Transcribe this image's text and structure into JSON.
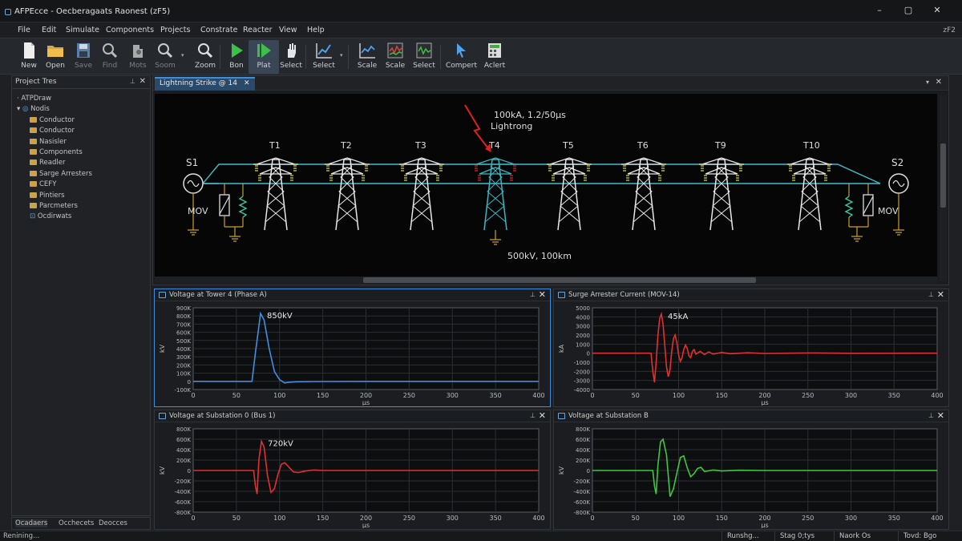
{
  "window": {
    "title": "AFPEcce - Oecberagaats Raonest (zF5)",
    "version": "zF2"
  },
  "menu": [
    "File",
    "Edit",
    "Simulate",
    "Components",
    "Projects",
    "Constrate",
    "Reacter",
    "View",
    "Help"
  ],
  "toolbar": [
    {
      "label": "New",
      "icon": "new-file-icon",
      "enabled": true
    },
    {
      "label": "Open",
      "icon": "open-folder-icon",
      "enabled": true
    },
    {
      "label": "Save",
      "icon": "save-icon",
      "enabled": false
    },
    {
      "label": "Find",
      "icon": "find-icon",
      "enabled": false
    },
    {
      "label": "Mots",
      "icon": "tools-icon",
      "enabled": false
    },
    {
      "label": "Soom",
      "icon": "zoom-icon",
      "enabled": false
    },
    {
      "label": "Zoom",
      "icon": "zoom-icon",
      "enabled": true
    },
    {
      "label": "Bon",
      "icon": "run-icon",
      "enabled": true
    },
    {
      "label": "Plat",
      "icon": "plot-run-icon",
      "enabled": true,
      "active": true
    },
    {
      "label": "Select",
      "icon": "hand-icon",
      "enabled": true
    },
    {
      "label": "Select",
      "icon": "line-chart-icon",
      "enabled": true
    },
    {
      "label": "Scale",
      "icon": "scale-chart-icon",
      "enabled": true
    },
    {
      "label": "Scale",
      "icon": "grid-chart-icon",
      "enabled": true
    },
    {
      "label": "Select",
      "icon": "green-chart-icon",
      "enabled": true
    },
    {
      "label": "Compert",
      "icon": "cursor-icon",
      "enabled": true
    },
    {
      "label": "Aclert",
      "icon": "calculator-icon",
      "enabled": true
    }
  ],
  "project_tree": {
    "title": "Project Tres",
    "items": [
      {
        "label": "ATPDraw",
        "level": 0,
        "kind": "text"
      },
      {
        "label": "Nodis",
        "level": 0,
        "kind": "node"
      },
      {
        "label": "Conductor",
        "level": 1,
        "kind": "folder"
      },
      {
        "label": "Conductor",
        "level": 1,
        "kind": "folder"
      },
      {
        "label": "Nasisler",
        "level": 1,
        "kind": "folder"
      },
      {
        "label": "Components",
        "level": 1,
        "kind": "folder"
      },
      {
        "label": "Readler",
        "level": 1,
        "kind": "folder"
      },
      {
        "label": "Sarge Arresters",
        "level": 1,
        "kind": "folder"
      },
      {
        "label": "CEFY",
        "level": 1,
        "kind": "folder"
      },
      {
        "label": "Pintiers",
        "level": 1,
        "kind": "folder"
      },
      {
        "label": "Parcmeters",
        "level": 1,
        "kind": "folder"
      },
      {
        "label": "Ocdirwats",
        "level": 1,
        "kind": "special"
      }
    ]
  },
  "bottom_tabs": [
    "Ocadaers",
    "Occhecets",
    "Deocces"
  ],
  "status": {
    "left": "Renining...",
    "boxes": [
      "Runshg...",
      "Stag 0;tys",
      "Naork Os",
      "Tovd: Bgo"
    ]
  },
  "document": {
    "tab_label": "Lightning Strike @ 14",
    "lightning_label": [
      "100kA, 1.2/50µs",
      "Lightrong"
    ],
    "line_label": "500kV, 100km",
    "sources": [
      "S1",
      "S2"
    ],
    "mov_labels": [
      "MOV",
      "MOV"
    ],
    "towers": [
      "T1",
      "T2",
      "T3",
      "T4",
      "T5",
      "T6",
      "T9",
      "T10"
    ],
    "struck_tower": "T4",
    "colors": {
      "line": "#41bcc8",
      "struck": "#3ab6c4",
      "lightning": "#e02020",
      "tower": "#e8e8e8",
      "insulator": "#d8d820",
      "ground": "#c8a030"
    }
  },
  "plots": [
    {
      "title": "Voltage at Tower 4 (Phase A)",
      "peak_label": "850kV",
      "color": "#3f8fe0",
      "ylabel": "kV",
      "xlabel": "µs",
      "yticks": [
        "900K",
        "800K",
        "700K",
        "600K",
        "500K",
        "400K",
        "300K",
        "200K",
        "100K",
        "0",
        "-100K"
      ],
      "xticks": [
        "0",
        "50",
        "100",
        "150",
        "200",
        "250",
        "300",
        "350",
        "400"
      ],
      "chart_data": {
        "type": "line",
        "x_range": [
          0,
          400
        ],
        "y_range": [
          -100,
          900
        ],
        "series": [
          {
            "points": [
              [
                0,
                0
              ],
              [
                68,
                0
              ],
              [
                72,
                350
              ],
              [
                78,
                830
              ],
              [
                82,
                750
              ],
              [
                88,
                400
              ],
              [
                94,
                120
              ],
              [
                100,
                20
              ],
              [
                106,
                -20
              ],
              [
                112,
                -10
              ],
              [
                120,
                -5
              ],
              [
                140,
                -2
              ],
              [
                200,
                0
              ],
              [
                300,
                0
              ],
              [
                400,
                0
              ]
            ]
          }
        ]
      }
    },
    {
      "title": "Surge Arrester Current (MOV-14)",
      "peak_label": "45kA",
      "color": "#e03030",
      "ylabel": "kA",
      "xlabel": "µs",
      "yticks": [
        "5000",
        "4000",
        "3000",
        "2000",
        "1000",
        "0",
        "-1000",
        "-2000",
        "-3000",
        "-4000"
      ],
      "xticks": [
        "0",
        "50",
        "100",
        "150",
        "200",
        "250",
        "300",
        "350",
        "400"
      ],
      "chart_data": {
        "type": "line",
        "x_range": [
          0,
          400
        ],
        "y_range": [
          -4000,
          5000
        ],
        "series": [
          {
            "points": [
              [
                0,
                0
              ],
              [
                68,
                0
              ],
              [
                70,
                -2000
              ],
              [
                72,
                -3200
              ],
              [
                74,
                -1000
              ],
              [
                76,
                2000
              ],
              [
                78,
                3800
              ],
              [
                80,
                4300
              ],
              [
                82,
                3200
              ],
              [
                84,
                800
              ],
              [
                86,
                -1500
              ],
              [
                88,
                -2600
              ],
              [
                90,
                -1800
              ],
              [
                92,
                200
              ],
              [
                94,
                1600
              ],
              [
                96,
                2000
              ],
              [
                98,
                1200
              ],
              [
                100,
                -200
              ],
              [
                102,
                -900
              ],
              [
                104,
                -500
              ],
              [
                106,
                400
              ],
              [
                108,
                900
              ],
              [
                110,
                500
              ],
              [
                112,
                -300
              ],
              [
                114,
                -500
              ],
              [
                116,
                200
              ],
              [
                118,
                400
              ],
              [
                120,
                -100
              ],
              [
                125,
                200
              ],
              [
                130,
                -150
              ],
              [
                135,
                150
              ],
              [
                140,
                -100
              ],
              [
                150,
                80
              ],
              [
                160,
                -60
              ],
              [
                180,
                40
              ],
              [
                200,
                -30
              ],
              [
                250,
                20
              ],
              [
                300,
                -10
              ],
              [
                400,
                0
              ]
            ]
          }
        ]
      }
    },
    {
      "title": "Voltage at Substation 0 (Bus 1)",
      "peak_label": "720kV",
      "color": "#e03030",
      "ylabel": "kV",
      "xlabel": "µs",
      "yticks": [
        "800K",
        "600K",
        "400K",
        "200K",
        "0",
        "-200K",
        "-400K",
        "-600K",
        "-800K"
      ],
      "xticks": [
        "0",
        "50",
        "100",
        "150",
        "200",
        "250",
        "300",
        "350",
        "400"
      ],
      "chart_data": {
        "type": "line",
        "x_range": [
          0,
          400
        ],
        "y_range": [
          -800,
          800
        ],
        "series": [
          {
            "points": [
              [
                0,
                0
              ],
              [
                70,
                0
              ],
              [
                72,
                -300
              ],
              [
                74,
                -450
              ],
              [
                76,
                200
              ],
              [
                79,
                560
              ],
              [
                82,
                450
              ],
              [
                86,
                -100
              ],
              [
                90,
                -420
              ],
              [
                94,
                -350
              ],
              [
                98,
                -80
              ],
              [
                102,
                120
              ],
              [
                106,
                150
              ],
              [
                110,
                80
              ],
              [
                116,
                -30
              ],
              [
                122,
                -40
              ],
              [
                130,
                -10
              ],
              [
                140,
                10
              ],
              [
                150,
                0
              ],
              [
                200,
                0
              ],
              [
                400,
                0
              ]
            ]
          }
        ]
      }
    },
    {
      "title": "Voltage at Substation B",
      "peak_label": "",
      "color": "#3ec83e",
      "ylabel": "kV",
      "xlabel": "µs",
      "yticks": [
        "800K",
        "600K",
        "400K",
        "200K",
        "0",
        "-200K",
        "-400K",
        "-600K",
        "-800K"
      ],
      "xticks": [
        "0",
        "50",
        "100",
        "150",
        "200",
        "250",
        "300",
        "350",
        "400"
      ],
      "chart_data": {
        "type": "line",
        "x_range": [
          0,
          400
        ],
        "y_range": [
          -800,
          800
        ],
        "series": [
          {
            "points": [
              [
                0,
                0
              ],
              [
                70,
                0
              ],
              [
                72,
                -300
              ],
              [
                74,
                -450
              ],
              [
                76,
                100
              ],
              [
                79,
                550
              ],
              [
                82,
                600
              ],
              [
                86,
                300
              ],
              [
                90,
                -500
              ],
              [
                94,
                -350
              ],
              [
                98,
                -50
              ],
              [
                102,
                250
              ],
              [
                106,
                280
              ],
              [
                110,
                50
              ],
              [
                114,
                -120
              ],
              [
                118,
                -60
              ],
              [
                122,
                40
              ],
              [
                126,
                60
              ],
              [
                130,
                -20
              ],
              [
                140,
                10
              ],
              [
                150,
                -10
              ],
              [
                170,
                5
              ],
              [
                200,
                0
              ],
              [
                400,
                0
              ]
            ]
          }
        ]
      }
    }
  ]
}
